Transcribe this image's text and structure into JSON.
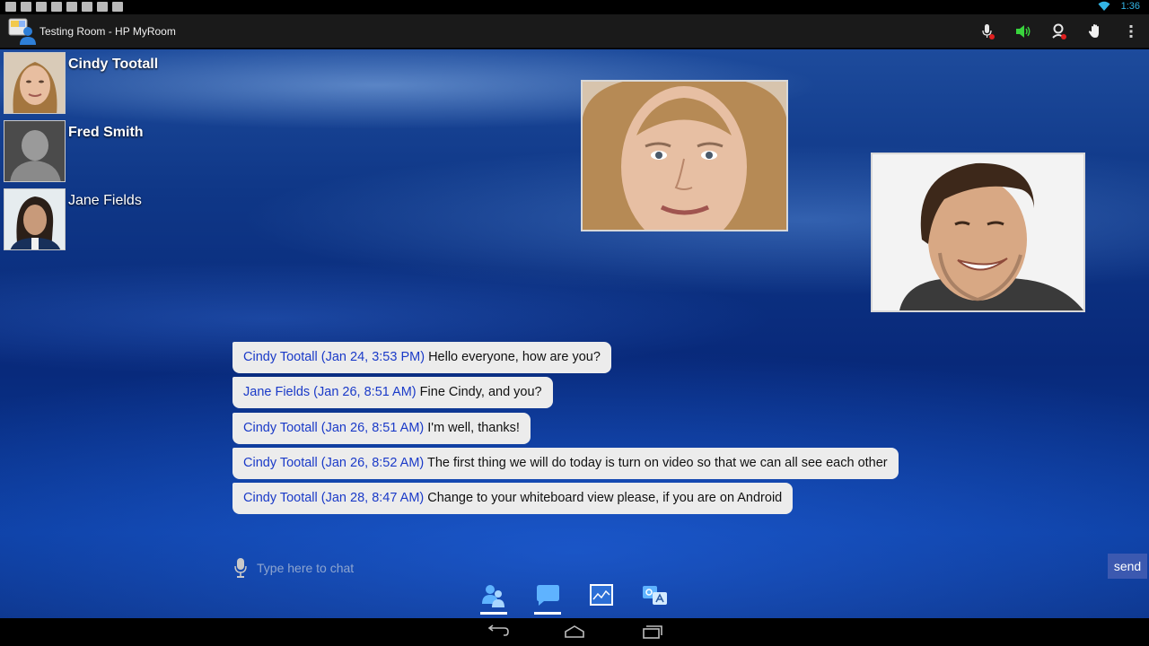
{
  "status_bar": {
    "notification_icons": [
      "image-icon",
      "mail-icon",
      "mail-icon",
      "wifi-notify-icon",
      "checkbox-icon",
      "checkbox-icon",
      "checkbox-icon",
      "android-icon"
    ],
    "time": "1:36",
    "accent_color": "#33b5e5"
  },
  "action_bar": {
    "title": "Testing Room - HP MyRoom",
    "actions": [
      "microphone-muted-icon",
      "speaker-icon",
      "webcam-off-icon",
      "raise-hand-icon",
      "overflow-menu-icon"
    ]
  },
  "participants": [
    {
      "name": "Cindy Tootall",
      "avatar": "woman-blonde"
    },
    {
      "name": "Fred Smith",
      "avatar": "default-silhouette"
    },
    {
      "name": "Jane Fields",
      "avatar": "woman-dark-hair"
    }
  ],
  "videos": [
    "cindy-video-feed",
    "man-video-feed"
  ],
  "chat": {
    "messages": [
      {
        "sender": "Cindy Tootall (Jan 24, 3:53 PM)",
        "text": "Hello everyone, how are you?"
      },
      {
        "sender": "Jane Fields (Jan 26, 8:51 AM)",
        "text": "Fine Cindy, and you?"
      },
      {
        "sender": "Cindy Tootall (Jan 26, 8:51 AM)",
        "text": "I'm well, thanks!"
      },
      {
        "sender": "Cindy Tootall (Jan 26, 8:52 AM)",
        "text": "The first thing we will do today is turn on video so that we can all see each other"
      },
      {
        "sender": "Cindy Tootall (Jan 28, 8:47 AM)",
        "text": "Change to your whiteboard view please, if you are on Android"
      }
    ],
    "input_placeholder": "Type here to chat",
    "input_value": "",
    "send_label": "send",
    "sender_color": "#1a3ac8"
  },
  "tabs": [
    {
      "icon": "people-icon",
      "active": true
    },
    {
      "icon": "chat-bubble-icon",
      "active": true
    },
    {
      "icon": "whiteboard-icon",
      "active": false
    },
    {
      "icon": "translate-icon",
      "active": false
    }
  ],
  "nav_bar": [
    "back-icon",
    "home-icon",
    "recent-apps-icon"
  ]
}
